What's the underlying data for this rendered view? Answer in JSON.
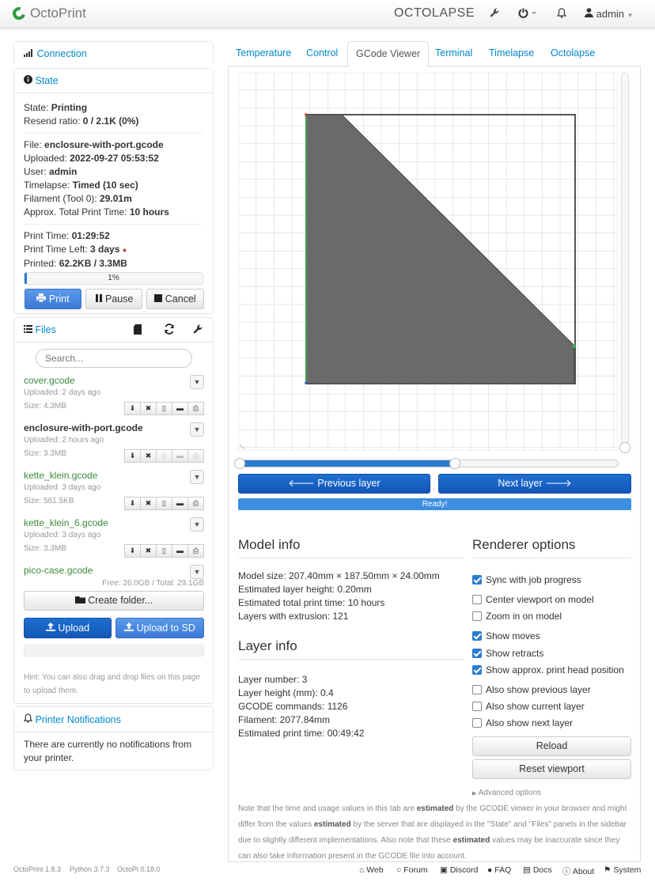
{
  "navbar": {
    "brand": "OctoPrint",
    "title": "OCTOLAPSE",
    "user": "admin"
  },
  "connection": {
    "label": "Connection"
  },
  "state": {
    "title": "State",
    "state_label": "State:",
    "state_value": "Printing",
    "resend_label": "Resend ratio:",
    "resend_value": "0 / 2.1K (0%)",
    "file_label": "File:",
    "file_value": "enclosure-with-port.gcode",
    "uploaded_label": "Uploaded:",
    "uploaded_value": "2022-09-27 05:53:52",
    "user_label": "User:",
    "user_value": "admin",
    "timelapse_label": "Timelapse:",
    "timelapse_value": "Timed (10 sec)",
    "filament_label": "Filament (Tool 0):",
    "filament_value": "29.01m",
    "approx_label": "Approx. Total Print Time:",
    "approx_value": "10 hours",
    "printtime_label": "Print Time:",
    "printtime_value": "01:29:52",
    "left_label": "Print Time Left:",
    "left_value": "3 days",
    "printed_label": "Printed:",
    "printed_value": "62.2KB / 3.3MB",
    "progress_text": "1%",
    "progress": 0.01,
    "print_btn": "Print",
    "pause_btn": "Pause",
    "cancel_btn": "Cancel"
  },
  "files": {
    "title": "Files",
    "search_placeholder": "Search...",
    "items": [
      {
        "name": "cover.gcode",
        "uploaded": "Uploaded: 2 days ago",
        "size": "Size: 4.3MB"
      },
      {
        "name": "enclosure-with-port.gcode",
        "uploaded": "Uploaded: 2 hours ago",
        "size": "Size: 3.3MB"
      },
      {
        "name": "kette_klein.gcode",
        "uploaded": "Uploaded: 3 days ago",
        "size": "Size: 561.5KB"
      },
      {
        "name": "kette_klein_6.gcode",
        "uploaded": "Uploaded: 3 days ago",
        "size": "Size: 3.3MB"
      },
      {
        "name": "pico-case.gcode"
      }
    ],
    "storage": "Free: 26.0GB / Total: 29.1GB",
    "create_folder": "Create folder...",
    "upload": "Upload",
    "upload_sd": "Upload to SD",
    "hint": "Hint: You can also drag and drop files on this page to upload them."
  },
  "notifications": {
    "title": "Printer Notifications",
    "body": "There are currently no notifications from your printer."
  },
  "tabs": [
    "Temperature",
    "Control",
    "GCode Viewer",
    "Terminal",
    "Timelapse",
    "Octolapse"
  ],
  "viewer": {
    "prev_layer": "Previous layer",
    "next_layer": "Next layer",
    "status": "Ready!",
    "layer_slider": 0.57
  },
  "model_info": {
    "title": "Model info",
    "size": "Model size: 207.40mm × 187.50mm × 24.00mm",
    "layer_height": "Estimated layer height: 0.20mm",
    "print_time": "Estimated total print time: 10 hours",
    "layers": "Layers with extrusion: 121"
  },
  "layer_info": {
    "title": "Layer info",
    "number": "Layer number: 3",
    "height": "Layer height (mm): 0.4",
    "gcode": "GCODE commands: 1126",
    "filament": "Filament: 2077.84mm",
    "time": "Estimated print time: 00:49:42"
  },
  "renderer": {
    "title": "Renderer options",
    "options": [
      {
        "label": "Sync with job progress",
        "checked": true
      },
      {
        "label": "Center viewport on model",
        "checked": false
      },
      {
        "label": "Zoom in on model",
        "checked": false
      },
      {
        "label": "Show moves",
        "checked": true
      },
      {
        "label": "Show retracts",
        "checked": true
      },
      {
        "label": "Show approx. print head position",
        "checked": true
      },
      {
        "label": "Also show previous layer",
        "checked": false
      },
      {
        "label": "Also show current layer",
        "checked": false
      },
      {
        "label": "Also show next layer",
        "checked": false
      }
    ],
    "reload": "Reload",
    "reset": "Reset viewport",
    "advanced": "Advanced options"
  },
  "note": {
    "p1": "Note that the time and usage values in this tab are ",
    "b1": "estimated",
    "p2": " by the GCODE viewer in your browser and might differ from the values ",
    "b2": "estimated",
    "p3": " by the server that are displayed in the \"State\" and \"Files\" panels in the sidebar due to slightly different implementations. Also note that these ",
    "b3": "estimated",
    "p4": " values may be inaccurate since they can also take information present in the GCODE file into account."
  },
  "footer": {
    "octoprint": "OctoPrint 1.8.3",
    "python": "Python 3.7.3",
    "octopi": "OctoPi 0.18.0",
    "links": [
      "Web",
      "Forum",
      "Discord",
      "FAQ",
      "Docs",
      "About",
      "System"
    ]
  }
}
